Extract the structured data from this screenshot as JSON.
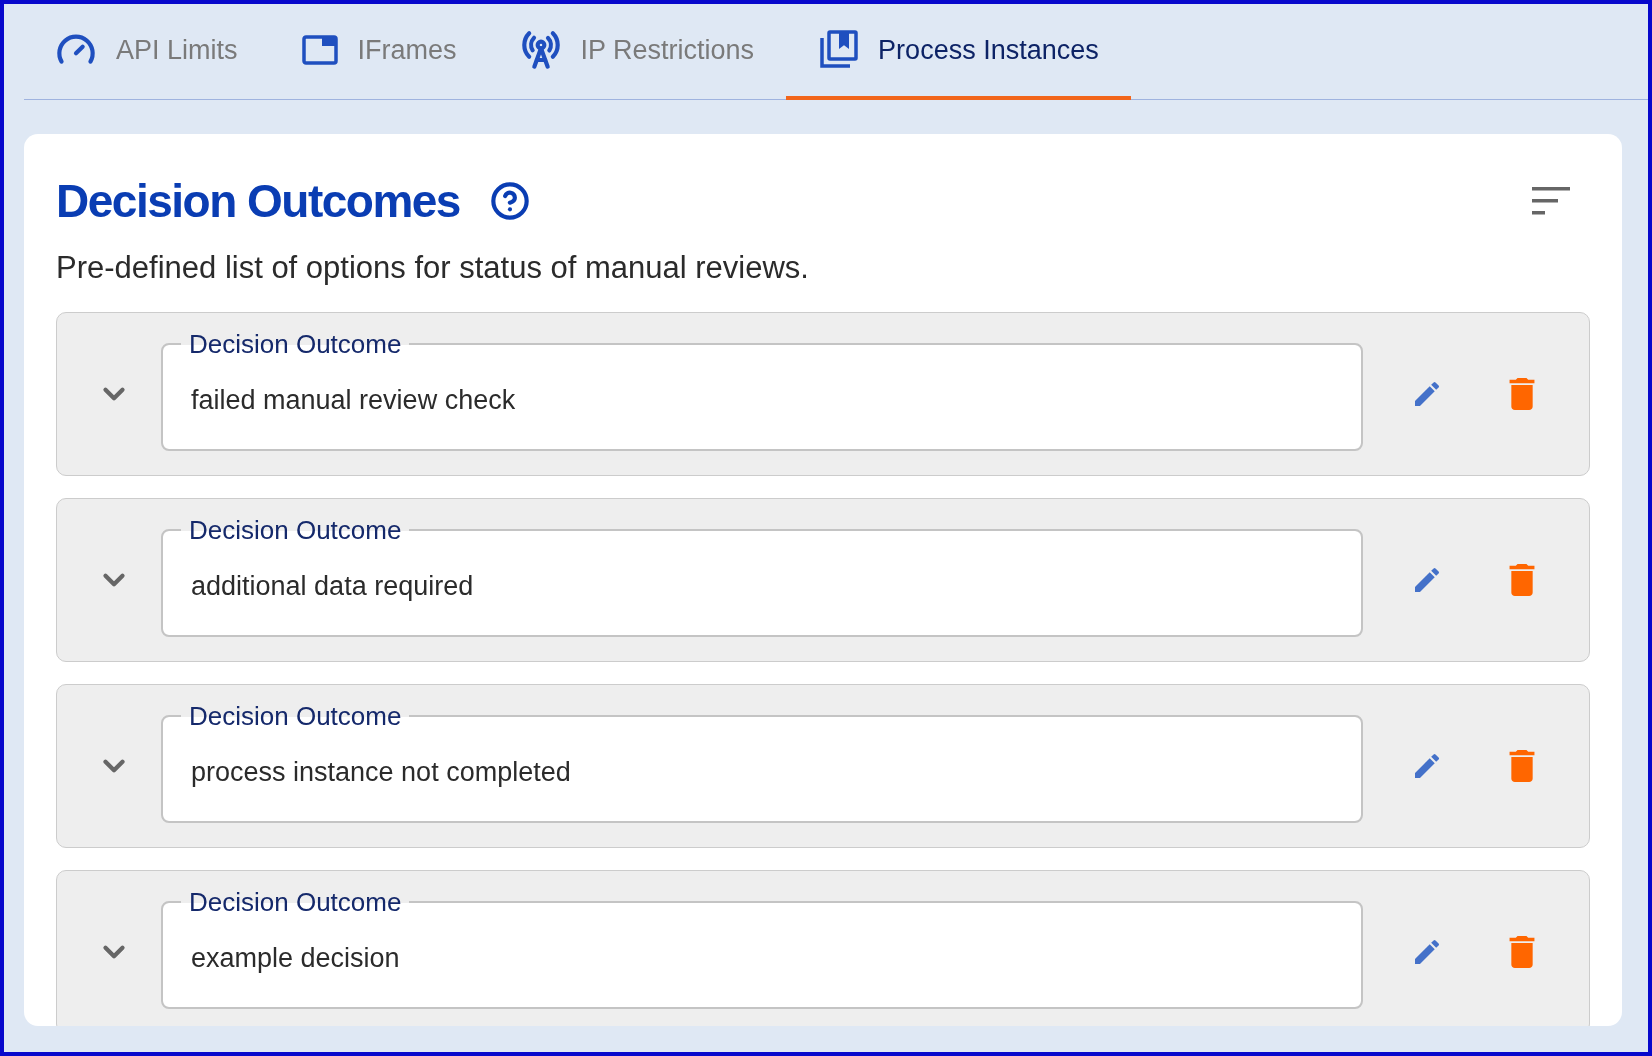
{
  "tabs": [
    {
      "label": "API Limits",
      "selected": false
    },
    {
      "label": "IFrames",
      "selected": false
    },
    {
      "label": "IP Restrictions",
      "selected": false
    },
    {
      "label": "Process Instances",
      "selected": true
    }
  ],
  "section": {
    "title": "Decision Outcomes",
    "description": "Pre-defined list of options for status of manual reviews."
  },
  "outcomes": [
    {
      "label": "Decision Outcome",
      "value": "failed manual review check"
    },
    {
      "label": "Decision Outcome",
      "value": "additional data required"
    },
    {
      "label": "Decision Outcome",
      "value": "process instance not completed"
    },
    {
      "label": "Decision Outcome",
      "value": "example decision"
    }
  ]
}
